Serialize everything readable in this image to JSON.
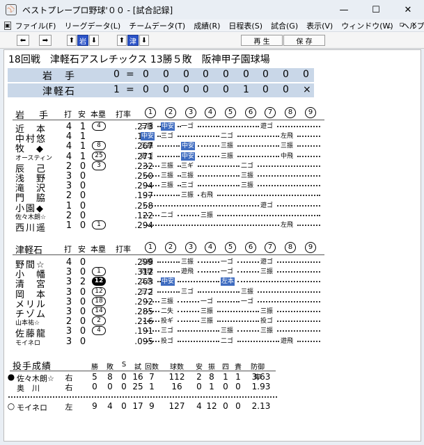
{
  "window": {
    "title": "ベストプレープロ野球'００ - [試合記録]",
    "app_icon": "baseball-app-icon",
    "min": "—",
    "max": "☐",
    "close": "✕"
  },
  "menu": {
    "items": [
      "ファイル(F)",
      "リーグデータ(L)",
      "チームデータ(T)",
      "成績(R)",
      "日程表(S)",
      "試合(G)",
      "表示(V)",
      "ウィンドウ(W)",
      "ヘルプ(H)"
    ],
    "mdi": [
      "_",
      "▫",
      "×"
    ]
  },
  "toolbar": {
    "team1": "岩",
    "team2": "津",
    "play": "再 生",
    "save": "保 存"
  },
  "game": {
    "header": "18回戦　津軽石アスレチックス 13勝５敗　阪神甲子園球場"
  },
  "linescore": [
    {
      "team": "岩　手",
      "runs": "0",
      "eq": "=",
      "innings": [
        "0",
        "0",
        "0",
        "0",
        "0",
        "0",
        "0",
        "0",
        "0"
      ]
    },
    {
      "team": "津軽石",
      "runs": "1",
      "eq": "=",
      "innings": [
        "0",
        "0",
        "0",
        "0",
        "0",
        "1",
        "0",
        "0",
        "×"
      ]
    }
  ],
  "columns": {
    "ab": "打",
    "h": "安",
    "hr": "本塁",
    "avg": "打率",
    "innings": [
      "1",
      "2",
      "3",
      "4",
      "5",
      "6",
      "7",
      "8",
      "9"
    ]
  },
  "away": {
    "team": "岩　手",
    "players": [
      {
        "name": "近　本",
        "ab": "4",
        "h": "1",
        "hr": "4",
        "hr_style": "circle",
        "avg": ".273",
        "plays": [
          {
            "i": 1,
            "t": "三振"
          },
          {
            "i": 2,
            "t": "中安",
            "hit": true
          },
          {
            "i": 3,
            "t": "一ゴ"
          },
          {
            "i": 7,
            "t": "遊ゴ"
          }
        ]
      },
      {
        "name": "中村悠",
        "ab": "4",
        "h": "1",
        "hr": "",
        "avg": ".143",
        "plays": [
          {
            "i": 1,
            "t": "中安",
            "hit": true
          },
          {
            "i": 2,
            "t": "三ゴ"
          },
          {
            "i": 5,
            "t": "二ゴ"
          },
          {
            "i": 8,
            "t": "左飛"
          }
        ]
      },
      {
        "name": "牧　◆",
        "ab": "4",
        "h": "1",
        "hr": "8",
        "hr_style": "circle",
        "avg": ".267",
        "plays": [
          {
            "i": 1,
            "t": "三振"
          },
          {
            "i": 3,
            "t": "中安",
            "hit": true
          },
          {
            "i": 5,
            "t": "三振"
          },
          {
            "i": 8,
            "t": "三振"
          }
        ]
      },
      {
        "name": "オースティン",
        "small": true,
        "ab": "4",
        "h": "1",
        "hr": "25",
        "hr_style": "circle",
        "avg": ".271",
        "plays": [
          {
            "i": 1,
            "t": "遊ゴ"
          },
          {
            "i": 3,
            "t": "中安",
            "hit": true
          },
          {
            "i": 5,
            "t": "三振"
          },
          {
            "i": 8,
            "t": "中飛"
          }
        ]
      },
      {
        "name": "辰　己",
        "ab": "2",
        "h": "0",
        "hr": "3",
        "hr_style": "circle",
        "avg": ".232",
        "plays": [
          {
            "i": 2,
            "t": "三振"
          },
          {
            "i": 3,
            "t": "三ギ"
          },
          {
            "i": 6,
            "t": "二ゴ"
          }
        ]
      },
      {
        "name": "浅　野",
        "ab": "3",
        "h": "0",
        "hr": "",
        "avg": ".250",
        "plays": [
          {
            "i": 2,
            "t": "三振"
          },
          {
            "i": 3,
            "t": "三振"
          },
          {
            "i": 6,
            "t": "三振"
          }
        ]
      },
      {
        "name": "滝　沢",
        "ab": "3",
        "h": "0",
        "hr": "",
        "avg": ".294",
        "plays": [
          {
            "i": 2,
            "t": "三振"
          },
          {
            "i": 3,
            "t": "三ゴ"
          },
          {
            "i": 6,
            "t": "三振"
          }
        ]
      },
      {
        "name": "門　脇",
        "ab": "2",
        "h": "0",
        "hr": "",
        "avg": ".197",
        "plays": [
          {
            "i": 3,
            "t": "三振"
          },
          {
            "i": 4,
            "t": "右飛"
          }
        ]
      },
      {
        "name": "小園◆",
        "ab": "1",
        "h": "0",
        "hr": "",
        "avg": ".258",
        "plays": [
          {
            "i": 7,
            "t": "遊ゴ"
          }
        ]
      },
      {
        "name": "佐々木朗☆",
        "small": true,
        "ab": "2",
        "h": "0",
        "hr": "",
        "avg": ".122",
        "plays": [
          {
            "i": 2,
            "t": "二ゴ"
          },
          {
            "i": 4,
            "t": "三振"
          }
        ]
      },
      {
        "name": "西川遥",
        "ab": "1",
        "h": "0",
        "hr": "1",
        "hr_style": "circle",
        "avg": ".294",
        "plays": [
          {
            "i": 8,
            "t": "左飛"
          }
        ]
      }
    ]
  },
  "home": {
    "team": "津軽石",
    "players": [
      {
        "name": "野間☆",
        "ab": "4",
        "h": "0",
        "hr": "",
        "avg": ".299",
        "plays": [
          {
            "i": 1,
            "t": "三振"
          },
          {
            "i": 3,
            "t": "三振"
          },
          {
            "i": 5,
            "t": "一ゴ"
          },
          {
            "i": 7,
            "t": "遊ゴ"
          }
        ]
      },
      {
        "name": "小　幡",
        "ab": "3",
        "h": "0",
        "hr": "1",
        "hr_style": "circle",
        "avg": ".312",
        "plays": [
          {
            "i": 1,
            "t": "四球"
          },
          {
            "i": 3,
            "t": "遊飛"
          },
          {
            "i": 5,
            "t": "一ゴ"
          },
          {
            "i": 7,
            "t": "三振"
          }
        ]
      },
      {
        "name": "清　宮",
        "ab": "3",
        "h": "2",
        "hr": "12",
        "hr_style": "filled",
        "avg": ".263",
        "plays": [
          {
            "i": 1,
            "t": "二失"
          },
          {
            "i": 2,
            "t": "中安",
            "hit": true
          },
          {
            "i": 5,
            "t": "左本",
            "hit": true
          }
        ]
      },
      {
        "name": "岡　本",
        "ab": "3",
        "h": "0",
        "hr": "12",
        "hr_style": "circle",
        "avg": ".272",
        "plays": [
          {
            "i": 1,
            "t": "三ゴ"
          },
          {
            "i": 3,
            "t": "三ゴ"
          },
          {
            "i": 6,
            "t": "三振"
          }
        ]
      },
      {
        "name": "メリル",
        "ab": "3",
        "h": "0",
        "hr": "18",
        "hr_style": "circle",
        "avg": ".292",
        "plays": [
          {
            "i": 2,
            "t": "三振"
          },
          {
            "i": 4,
            "t": "一ゴ"
          },
          {
            "i": 6,
            "t": "一ゴ"
          }
        ]
      },
      {
        "name": "チゾム",
        "ab": "3",
        "h": "0",
        "hr": "14",
        "hr_style": "circle",
        "avg": ".285",
        "plays": [
          {
            "i": 2,
            "t": "二失"
          },
          {
            "i": 4,
            "t": "三振"
          },
          {
            "i": 7,
            "t": "三振"
          }
        ]
      },
      {
        "name": "山本祐☆",
        "small": true,
        "ab": "2",
        "h": "0",
        "hr": "2",
        "hr_style": "circle",
        "avg": ".216",
        "plays": [
          {
            "i": 2,
            "t": "投ギ"
          },
          {
            "i": 4,
            "t": "三振"
          },
          {
            "i": 7,
            "t": "投ゴ"
          }
        ]
      },
      {
        "name": "佐藤龍",
        "ab": "3",
        "h": "0",
        "hr": "4",
        "hr_style": "circle",
        "avg": ".191",
        "plays": [
          {
            "i": 2,
            "t": "三ゴ"
          },
          {
            "i": 5,
            "t": "三振"
          },
          {
            "i": 7,
            "t": "三振"
          }
        ]
      },
      {
        "name": "モイネロ",
        "small": true,
        "ab": "3",
        "h": "0",
        "hr": "",
        "avg": ".095",
        "plays": [
          {
            "i": 2,
            "t": "投ゴ"
          },
          {
            "i": 5,
            "t": "二ゴ"
          },
          {
            "i": 8,
            "t": "遊飛"
          }
        ]
      }
    ]
  },
  "pitching": {
    "title": "投手成績",
    "headers": [
      "勝",
      "敗",
      "S",
      "試",
      "回数",
      "球数",
      "安",
      "振",
      "四",
      "責",
      "防御率"
    ],
    "rows": [
      {
        "mark": "●",
        "name": "佐々木朗☆",
        "hand": "右",
        "vals": [
          "5",
          "8",
          "0",
          "16",
          "7",
          "112",
          "2",
          "8",
          "1",
          "1",
          "3.63"
        ]
      },
      {
        "mark": "",
        "name": "奥　川",
        "hand": "右",
        "vals": [
          "0",
          "0",
          "0",
          "25",
          "1",
          "16",
          "0",
          "1",
          "0",
          "0",
          "1.93"
        ]
      }
    ],
    "winner": {
      "mark": "○",
      "name": "モイネロ",
      "hand": "左",
      "vals": [
        "9",
        "4",
        "0",
        "17",
        "9",
        "127",
        "4",
        "12",
        "0",
        "0",
        "2.13"
      ]
    }
  }
}
